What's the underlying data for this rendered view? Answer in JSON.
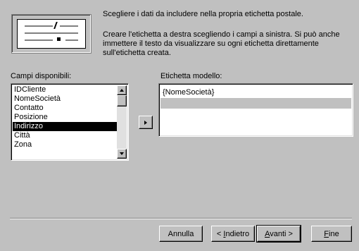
{
  "intro": {
    "line1": "Scegliere i dati da includere nella propria etichetta postale.",
    "line2": "Creare l'etichetta a destra scegliendo i campi a sinistra.  Si può anche immettere il testo da visualizzare su ogni etichetta direttamente sull'etichetta creata."
  },
  "available_fields": {
    "label": "Campi disponibili:",
    "items": [
      "IDCliente",
      "NomeSocietà",
      "Contatto",
      "Posizione",
      "Indirizzo",
      "Città",
      "Zona"
    ],
    "selected": "Indirizzo"
  },
  "add_button": {
    "glyph": "right-arrow-icon"
  },
  "sample_label": {
    "label": "Etichetta modello:",
    "rows": [
      "{NomeSocietà}",
      ""
    ]
  },
  "buttons": {
    "cancel": "Annulla",
    "back_prefix": "< ",
    "back_key": "I",
    "back_rest": "ndietro",
    "next_key": "A",
    "next_rest": "vanti >",
    "finish_key": "F",
    "finish_rest": "ine"
  }
}
